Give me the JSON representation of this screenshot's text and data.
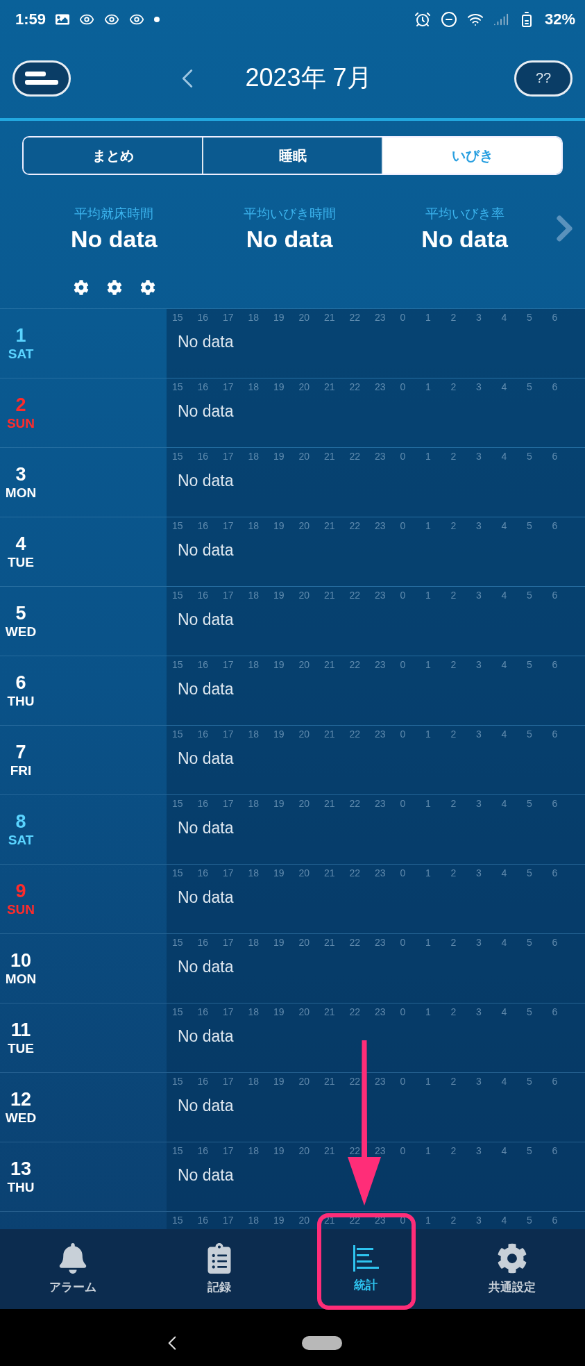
{
  "status_bar": {
    "time": "1:59",
    "battery": "32%"
  },
  "header": {
    "title": "2023年 7月",
    "help": "??"
  },
  "tabs": [
    {
      "label": "まとめ",
      "selected": false
    },
    {
      "label": "睡眠",
      "selected": false
    },
    {
      "label": "いびき",
      "selected": true
    }
  ],
  "stats": [
    {
      "label": "平均就床時間",
      "value": "No data"
    },
    {
      "label": "平均いびき時間",
      "value": "No data"
    },
    {
      "label": "平均いびき率",
      "value": "No data"
    }
  ],
  "days": [
    {
      "date": "1",
      "weekday": "SAT",
      "color": "#5ad4ff",
      "status": "No data",
      "hours": [
        "15",
        "16",
        "17",
        "18",
        "19",
        "20",
        "21",
        "22",
        "23",
        "0",
        "1",
        "2",
        "3",
        "4",
        "5",
        "6"
      ]
    },
    {
      "date": "2",
      "weekday": "SUN",
      "color": "#ff2b2b",
      "status": "No data",
      "hours": [
        "15",
        "16",
        "17",
        "18",
        "19",
        "20",
        "21",
        "22",
        "23",
        "0",
        "1",
        "2",
        "3",
        "4",
        "5",
        "6"
      ]
    },
    {
      "date": "3",
      "weekday": "MON",
      "color": "#ffffff",
      "status": "No data",
      "hours": [
        "15",
        "16",
        "17",
        "18",
        "19",
        "20",
        "21",
        "22",
        "23",
        "0",
        "1",
        "2",
        "3",
        "4",
        "5",
        "6"
      ]
    },
    {
      "date": "4",
      "weekday": "TUE",
      "color": "#ffffff",
      "status": "No data",
      "hours": [
        "15",
        "16",
        "17",
        "18",
        "19",
        "20",
        "21",
        "22",
        "23",
        "0",
        "1",
        "2",
        "3",
        "4",
        "5",
        "6"
      ]
    },
    {
      "date": "5",
      "weekday": "WED",
      "color": "#ffffff",
      "status": "No data",
      "hours": [
        "15",
        "16",
        "17",
        "18",
        "19",
        "20",
        "21",
        "22",
        "23",
        "0",
        "1",
        "2",
        "3",
        "4",
        "5",
        "6"
      ]
    },
    {
      "date": "6",
      "weekday": "THU",
      "color": "#ffffff",
      "status": "No data",
      "hours": [
        "15",
        "16",
        "17",
        "18",
        "19",
        "20",
        "21",
        "22",
        "23",
        "0",
        "1",
        "2",
        "3",
        "4",
        "5",
        "6"
      ]
    },
    {
      "date": "7",
      "weekday": "FRI",
      "color": "#ffffff",
      "status": "No data",
      "hours": [
        "15",
        "16",
        "17",
        "18",
        "19",
        "20",
        "21",
        "22",
        "23",
        "0",
        "1",
        "2",
        "3",
        "4",
        "5",
        "6"
      ]
    },
    {
      "date": "8",
      "weekday": "SAT",
      "color": "#5ad4ff",
      "status": "No data",
      "hours": [
        "15",
        "16",
        "17",
        "18",
        "19",
        "20",
        "21",
        "22",
        "23",
        "0",
        "1",
        "2",
        "3",
        "4",
        "5",
        "6"
      ]
    },
    {
      "date": "9",
      "weekday": "SUN",
      "color": "#ff2b2b",
      "status": "No data",
      "hours": [
        "15",
        "16",
        "17",
        "18",
        "19",
        "20",
        "21",
        "22",
        "23",
        "0",
        "1",
        "2",
        "3",
        "4",
        "5",
        "6"
      ]
    },
    {
      "date": "10",
      "weekday": "MON",
      "color": "#ffffff",
      "status": "No data",
      "hours": [
        "15",
        "16",
        "17",
        "18",
        "19",
        "20",
        "21",
        "22",
        "23",
        "0",
        "1",
        "2",
        "3",
        "4",
        "5",
        "6"
      ]
    },
    {
      "date": "11",
      "weekday": "TUE",
      "color": "#ffffff",
      "status": "No data",
      "hours": [
        "15",
        "16",
        "17",
        "18",
        "19",
        "20",
        "21",
        "22",
        "23",
        "0",
        "1",
        "2",
        "3",
        "4",
        "5",
        "6"
      ]
    },
    {
      "date": "12",
      "weekday": "WED",
      "color": "#ffffff",
      "status": "No data",
      "hours": [
        "15",
        "16",
        "17",
        "18",
        "19",
        "20",
        "21",
        "22",
        "23",
        "0",
        "1",
        "2",
        "3",
        "4",
        "5",
        "6"
      ]
    },
    {
      "date": "13",
      "weekday": "THU",
      "color": "#ffffff",
      "status": "No data",
      "hours": [
        "15",
        "16",
        "17",
        "18",
        "19",
        "20",
        "21",
        "22",
        "23",
        "0",
        "1",
        "2",
        "3",
        "4",
        "5",
        "6"
      ]
    },
    {
      "hours": [
        "15",
        "16",
        "17",
        "18",
        "19",
        "20",
        "21",
        "22",
        "23",
        "0",
        "1",
        "2",
        "3",
        "4",
        "5",
        "6"
      ]
    }
  ],
  "nav": [
    {
      "kind": "alarm",
      "label": "アラーム",
      "selected": false,
      "highlighted": false
    },
    {
      "kind": "record",
      "label": "記録",
      "selected": false,
      "highlighted": false
    },
    {
      "kind": "stats",
      "label": "統計",
      "selected": true,
      "highlighted": true
    },
    {
      "kind": "settings",
      "label": "共通設定",
      "selected": false,
      "highlighted": false
    }
  ]
}
